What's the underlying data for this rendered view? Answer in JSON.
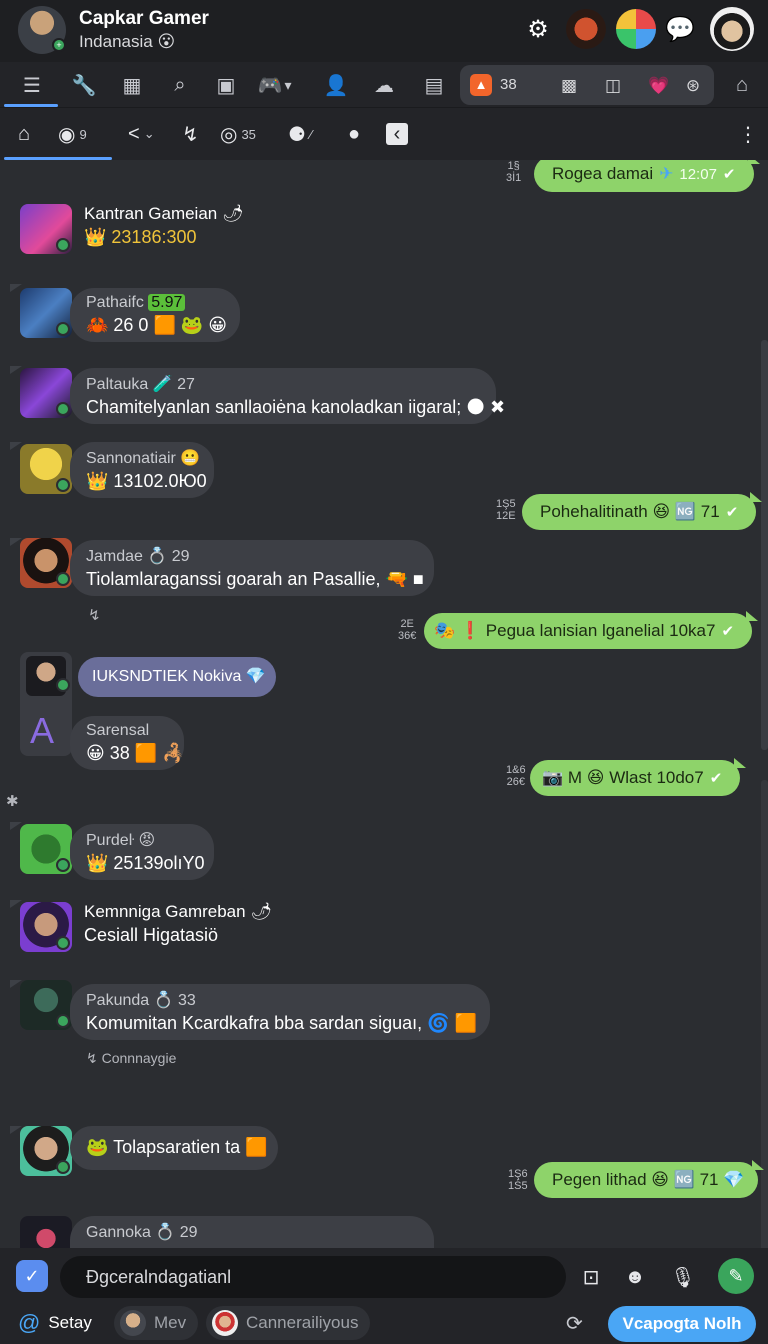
{
  "header": {
    "name": "Capkar Gamer",
    "status": "Indanasia 😮",
    "icons": [
      "gear-icon",
      "character-avatar",
      "app-logo-icon",
      "chat-bubble-icon",
      "profile-avatar"
    ]
  },
  "tabs": {
    "pill_count": "38",
    "icons": [
      "menu-icon",
      "wrench-icon",
      "grid-icon",
      "search-icon",
      "cube-icon",
      "game-icon",
      "chevron-down-icon",
      "person-icon",
      "cloud-icon",
      "calendar-icon",
      "home-icon"
    ]
  },
  "subtabs": {
    "items": [
      {
        "icon": "⌂",
        "label": ""
      },
      {
        "icon": "◉",
        "label": "9"
      },
      {
        "icon": "<",
        "label": "⌄"
      },
      {
        "icon": "↯",
        "label": ""
      },
      {
        "icon": "◎",
        "label": "35"
      },
      {
        "icon": "⚈",
        "label": "⁄"
      },
      {
        "icon": "●",
        "label": ""
      },
      {
        "icon": "‹",
        "label": ""
      }
    ]
  },
  "messages": {
    "m0_out": {
      "text": "Rogea damai",
      "time": "12:07",
      "ts": "1§\n3İ1"
    },
    "m1": {
      "name": "Kantran Gameian 🌶",
      "text": "👑 23186:300"
    },
    "m2": {
      "name": "Pathaifc",
      "badge": "5.97",
      "text": "🦀 26  0 🟧 🐸 😀"
    },
    "m3": {
      "name": "Paltauka 🧪 27",
      "text": "Chamitelyanlan sanllaoiėna kanoladkan iigaral; 🌑 ✖"
    },
    "m4": {
      "name": "Sannonatiair 😬",
      "text": "👑 13102.0Ю0"
    },
    "m5_out": {
      "text": "Pohehalitinath 😆 🆖 71",
      "ts": "1Ş5\n12E"
    },
    "m6": {
      "name": "Jamdae 💍 29",
      "text": "Tiolamlaraganssi goarah an Pasallie, 🔫 ■"
    },
    "m6_note": "↯",
    "m7_out": {
      "text": "🎭 ❗ Pegua lanisian lganelial 10ka7",
      "ts": "2E\n36€"
    },
    "m8": {
      "tag": "IUKSNDTIEK Nokiva 💎",
      "name": "Sarensal",
      "text": "😀 38 🟧 🦂"
    },
    "m9_out": {
      "text": "📷 M 😆 Wlast 10do7",
      "ts": "1&6\n26€"
    },
    "m9_note": "✱",
    "m10": {
      "name": "Purdeŀ 😡",
      "text": "👑 25139olıY0"
    },
    "m11": {
      "name": "Kemnniga Gamreban 🌶",
      "text": "Cesiall Higatasiö"
    },
    "m12": {
      "name": "Pakunda 💍 33",
      "text": "Komumitan Kcardkafra bba sardan siguaı, 🌀 🟧"
    },
    "m12_note": "Connnaygie",
    "m13": {
      "text": "🐸 Tolapsaratien ta 🟧"
    },
    "m14_out": {
      "text": "Pegen lithad 😆 🆖 71 💎",
      "ts": "1Ş6\n1Ś5"
    },
    "m15": {
      "name": "Gannoka 💍 29"
    }
  },
  "composer": {
    "placeholder": "Ðgceralndagatianl",
    "chip1": "Setay",
    "chip2": "Mev",
    "chip3": "Cannerailiyous",
    "cta": "Vcapogta Nolh"
  },
  "colors": {
    "background": "#2b2d31",
    "header": "#1e1f22",
    "outgoing": "#8ed36a",
    "accent": "#4aa6f5",
    "online": "#3ba55d"
  }
}
